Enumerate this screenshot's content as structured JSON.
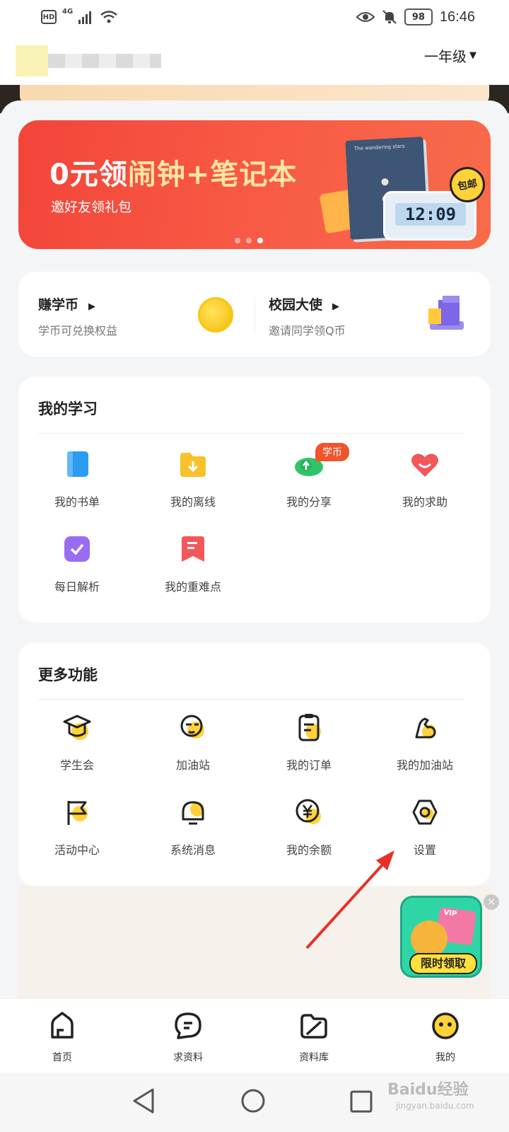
{
  "status_bar": {
    "hd": "HD",
    "signal": "4G",
    "battery": "98",
    "time": "16:46"
  },
  "header": {
    "grade": "一年级"
  },
  "banner": {
    "title_part1": "0元领",
    "title_part2": "闹钟+笔记本",
    "subtitle": "邀好友领礼包",
    "notebook_text": "The wandering stars",
    "clock_display": "12:09",
    "badge": "包邮"
  },
  "coins": [
    {
      "title": "赚学币",
      "subtitle": "学币可兑换权益"
    },
    {
      "title": "校园大使",
      "subtitle": "邀请同学领Q币"
    }
  ],
  "my_study": {
    "title": "我的学习",
    "badge": "学币",
    "items": [
      {
        "label": "我的书单",
        "icon": "book-icon",
        "color": "#2b9cf2"
      },
      {
        "label": "我的离线",
        "icon": "download-folder-icon",
        "color": "#f7c22c"
      },
      {
        "label": "我的分享",
        "icon": "share-cloud-icon",
        "color": "#2fc46a"
      },
      {
        "label": "我的求助",
        "icon": "heart-icon",
        "color": "#f2585a"
      },
      {
        "label": "每日解析",
        "icon": "check-square-icon",
        "color": "#9a6cf2"
      },
      {
        "label": "我的重难点",
        "icon": "bookmark-icon",
        "color": "#f2585a"
      }
    ]
  },
  "more": {
    "title": "更多功能",
    "items": [
      {
        "label": "学生会",
        "icon": "graduation-cap-icon"
      },
      {
        "label": "加油站",
        "icon": "face-icon"
      },
      {
        "label": "我的订单",
        "icon": "clipboard-icon"
      },
      {
        "label": "我的加油站",
        "icon": "muscle-icon"
      },
      {
        "label": "活动中心",
        "icon": "flag-icon"
      },
      {
        "label": "系统消息",
        "icon": "bell-icon"
      },
      {
        "label": "我的余额",
        "icon": "yuan-coin-icon"
      },
      {
        "label": "设置",
        "icon": "settings-icon"
      }
    ]
  },
  "promo": {
    "label": "限时领取",
    "vip": "VIP",
    "close": "×"
  },
  "bottom_nav": [
    {
      "label": "首页",
      "icon": "home-icon"
    },
    {
      "label": "求资料",
      "icon": "chat-icon"
    },
    {
      "label": "资料库",
      "icon": "folder-icon"
    },
    {
      "label": "我的",
      "icon": "smiley-icon"
    }
  ],
  "watermark": {
    "main": "Baidu经验",
    "sub": "jingyan.baidu.com"
  },
  "colors": {
    "accent_yellow": "#ffd23a",
    "banner_red": "#f2453a",
    "badge_orange": "#f0542d",
    "annotation_arrow": "#e8302a"
  }
}
